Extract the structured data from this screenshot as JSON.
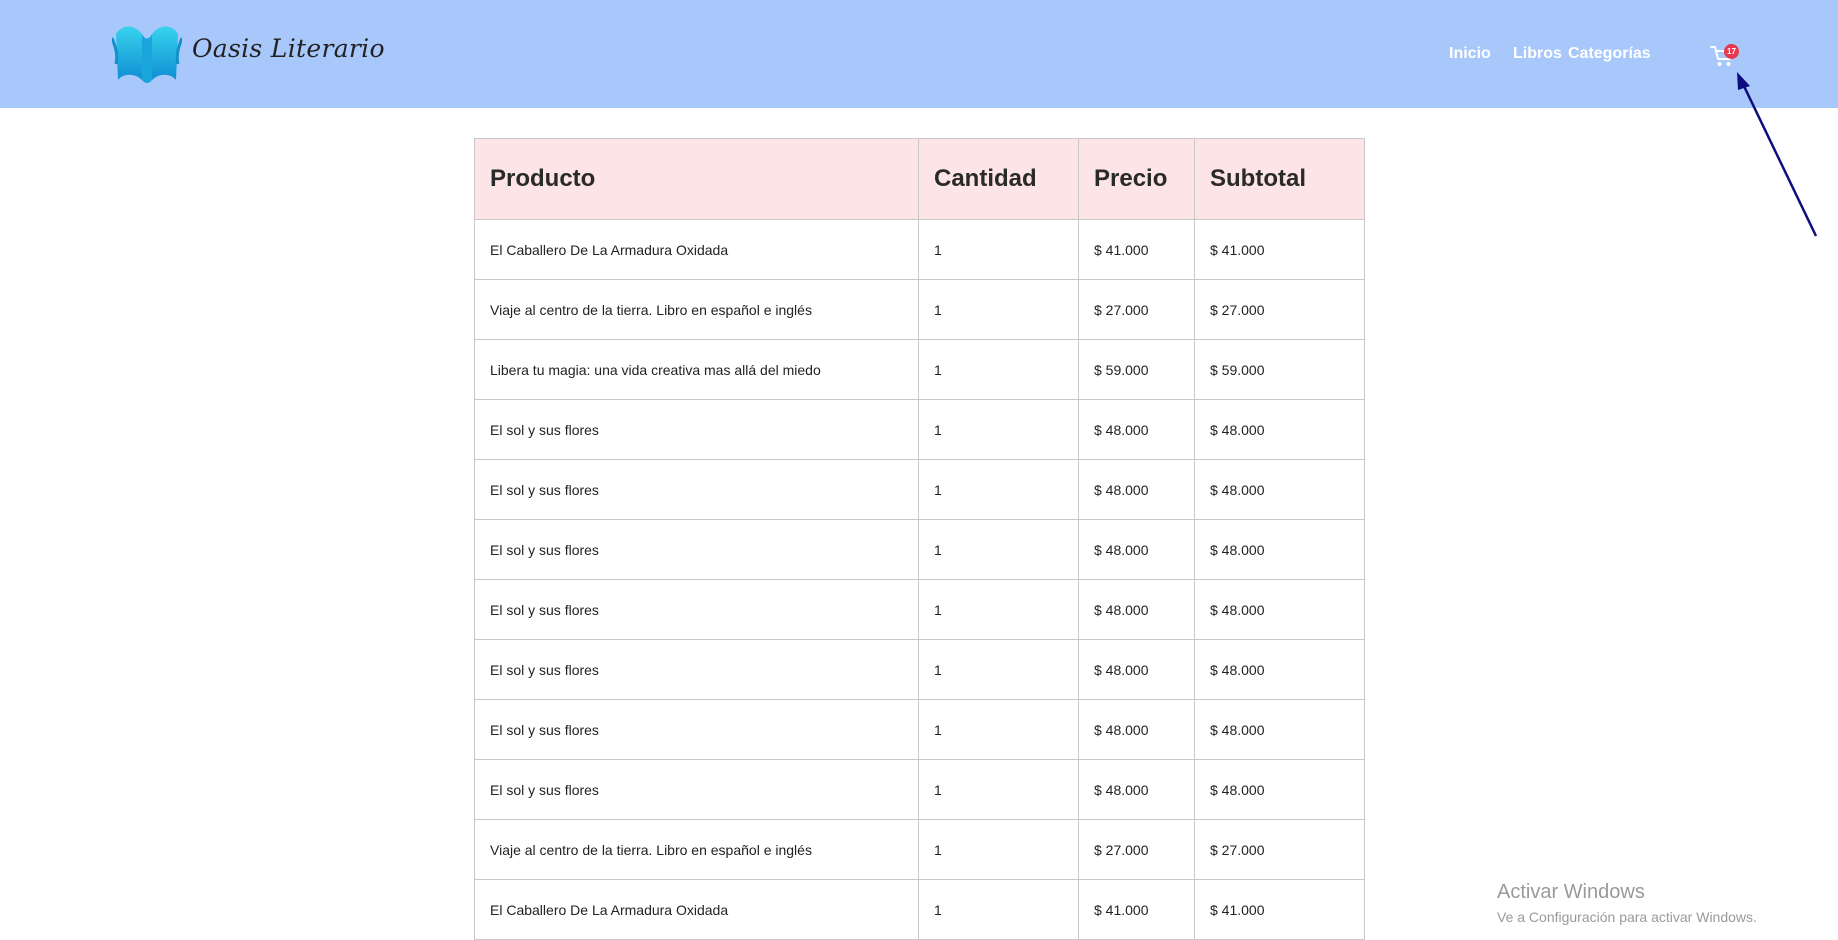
{
  "brand": {
    "name": "Oasis Literario"
  },
  "nav": {
    "inicio": "Inicio",
    "libros": "Libros",
    "categorias": "Categorías"
  },
  "cart": {
    "badge": "17",
    "icon": "cart-icon"
  },
  "colors": {
    "header_bg": "#a8c7fb",
    "table_header_bg": "#fde4e6",
    "badge": "#e8384f",
    "arrow": "#0d0d80"
  },
  "table": {
    "headers": [
      "Producto",
      "Cantidad",
      "Precio",
      "Subtotal"
    ],
    "rows": [
      {
        "product": "El Caballero De La Armadura Oxidada",
        "qty": "1",
        "price": "$ 41.000",
        "subtotal": "$ 41.000"
      },
      {
        "product": "Viaje al centro de la tierra. Libro en español e inglés",
        "qty": "1",
        "price": "$ 27.000",
        "subtotal": "$ 27.000"
      },
      {
        "product": "Libera tu magia: una vida creativa mas allá del miedo",
        "qty": "1",
        "price": "$ 59.000",
        "subtotal": "$ 59.000"
      },
      {
        "product": "El sol y sus flores",
        "qty": "1",
        "price": "$ 48.000",
        "subtotal": "$ 48.000"
      },
      {
        "product": "El sol y sus flores",
        "qty": "1",
        "price": "$ 48.000",
        "subtotal": "$ 48.000"
      },
      {
        "product": "El sol y sus flores",
        "qty": "1",
        "price": "$ 48.000",
        "subtotal": "$ 48.000"
      },
      {
        "product": "El sol y sus flores",
        "qty": "1",
        "price": "$ 48.000",
        "subtotal": "$ 48.000"
      },
      {
        "product": "El sol y sus flores",
        "qty": "1",
        "price": "$ 48.000",
        "subtotal": "$ 48.000"
      },
      {
        "product": "El sol y sus flores",
        "qty": "1",
        "price": "$ 48.000",
        "subtotal": "$ 48.000"
      },
      {
        "product": "El sol y sus flores",
        "qty": "1",
        "price": "$ 48.000",
        "subtotal": "$ 48.000"
      },
      {
        "product": "Viaje al centro de la tierra. Libro en español e inglés",
        "qty": "1",
        "price": "$ 27.000",
        "subtotal": "$ 27.000"
      },
      {
        "product": "El Caballero De La Armadura Oxidada",
        "qty": "1",
        "price": "$ 41.000",
        "subtotal": "$ 41.000"
      }
    ]
  },
  "watermark": {
    "title": "Activar Windows",
    "subtitle": "Ve a Configuración para activar Windows."
  }
}
